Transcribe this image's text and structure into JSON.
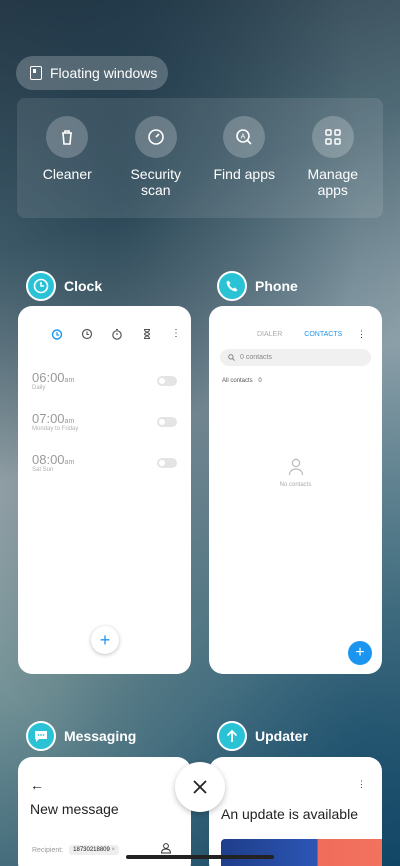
{
  "floating_windows": {
    "label": "Floating windows"
  },
  "tools": [
    {
      "label": "Cleaner",
      "icon": "trash-icon"
    },
    {
      "label": "Security scan",
      "icon": "security-gauge-icon"
    },
    {
      "label": "Find apps",
      "icon": "find-apps-icon"
    },
    {
      "label": "Manage apps",
      "icon": "grid-icon"
    }
  ],
  "cards": {
    "clock": {
      "title": "Clock",
      "alarms": [
        {
          "time": "06:00",
          "ampm": "am",
          "repeat": "Daily"
        },
        {
          "time": "07:00",
          "ampm": "am",
          "repeat": "Monday to Friday"
        },
        {
          "time": "08:00",
          "ampm": "am",
          "repeat": "Sat Sun"
        }
      ],
      "fab": "+"
    },
    "phone": {
      "title": "Phone",
      "tab_dialer": "DIALER",
      "tab_contacts": "CONTACTS",
      "search_placeholder": "0 contacts",
      "all_contacts": "All contacts",
      "all_contacts_count": "0",
      "empty_text": "No contacts",
      "fab": "+"
    },
    "messaging": {
      "title": "Messaging",
      "back": "←",
      "heading": "New message",
      "recipient_label": "Recipient:",
      "recipient_value": "18730218809",
      "recipient_remove": "×"
    },
    "updater": {
      "title": "Updater",
      "heading": "An update is available"
    }
  },
  "colors": {
    "accent_teal": "#2ac3d6",
    "accent_blue": "#1b95f0"
  }
}
